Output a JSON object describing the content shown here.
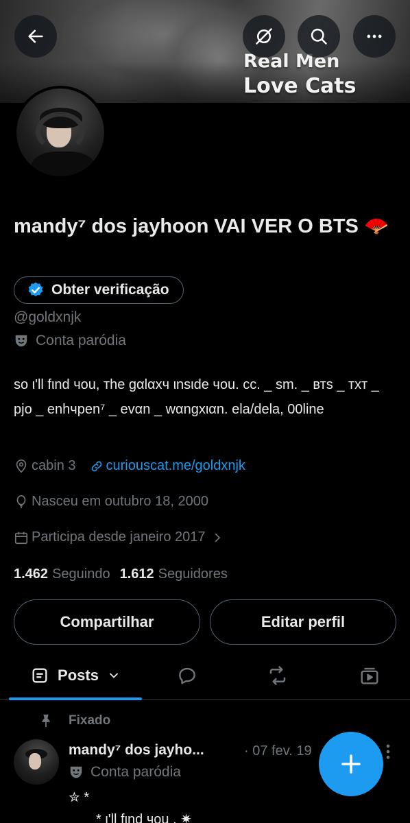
{
  "banner": {
    "text_line1": "Real Men",
    "text_line2": "Love Cats"
  },
  "header_icons": {
    "back": "arrow-left-icon",
    "grok": "grok-icon",
    "search": "search-icon",
    "more": "more-horizontal-icon"
  },
  "profile": {
    "display_name": "mandy⁷ dos jayhoon VAI VER O BTS 🪭",
    "verify_label": "Obter verificação",
    "handle": "@goldxnjk",
    "parody_label": "Conta paródia",
    "bio": "ѕo ι'll fιnd чou, тhe gαlαxч ιnѕιde чou. cc. _ ѕm. _ втѕ _ тхт _ pjo _ enhчpen⁷ _ evαn _ wαngхιαn. ela/dela, 00line",
    "location": "cabin 3",
    "link": "curiouscat.me/goldxnjk",
    "birthday": "Nasceu em outubro 18, 2000",
    "joined": "Participa desde janeiro 2017",
    "following_count": "1.462",
    "following_label": "Seguindo",
    "followers_count": "1.612",
    "followers_label": "Seguidores"
  },
  "actions": {
    "share": "Compartilhar",
    "edit": "Editar perfil"
  },
  "tabs": {
    "posts": "Posts"
  },
  "post": {
    "pinned_label": "Fixado",
    "name": "mandy⁷ dos jayho...",
    "date": "· 07 fev. 19",
    "parody_label": "Conta paródia",
    "line1": "✮ *",
    "line2": "*      ι'll fιnd чou   .  ✷"
  },
  "colors": {
    "accent": "#1d9bf0",
    "muted": "#71767b",
    "text": "#e7e9ea",
    "border": "#536471"
  }
}
